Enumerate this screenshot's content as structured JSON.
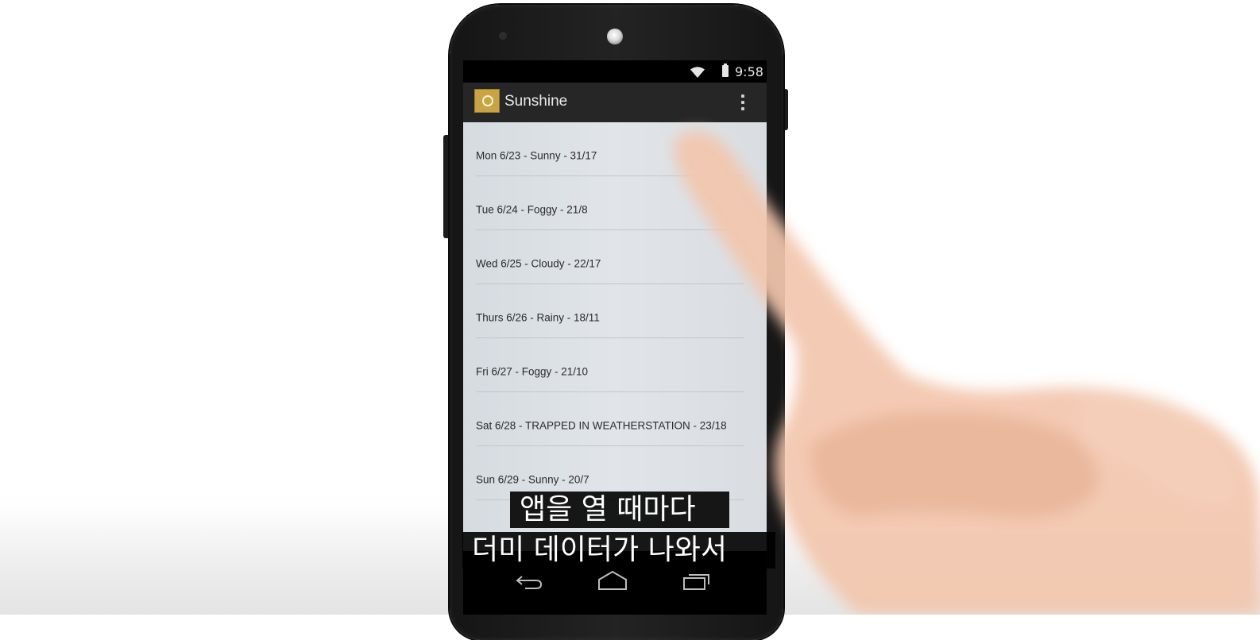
{
  "status_bar": {
    "time": "9:58",
    "wifi_icon": "wifi-icon",
    "battery_icon": "battery-icon"
  },
  "action_bar": {
    "app_icon": "sunshine-app-icon",
    "title": "Sunshine",
    "overflow_icon": "overflow-menu-icon"
  },
  "forecast_list": {
    "items": [
      {
        "label": "Mon 6/23  - Sunny - 31/17"
      },
      {
        "label": "Tue 6/24 - Foggy - 21/8"
      },
      {
        "label": "Wed 6/25 - Cloudy - 22/17"
      },
      {
        "label": "Thurs 6/26 - Rainy - 18/11"
      },
      {
        "label": "Fri 6/27 - Foggy - 21/10"
      },
      {
        "label": "Sat 6/28 - TRAPPED IN WEATHERSTATION - 23/18"
      },
      {
        "label": "Sun 6/29 - Sunny - 20/7"
      }
    ]
  },
  "nav_bar": {
    "back_icon": "back-icon",
    "home_icon": "home-icon",
    "recents_icon": "recents-icon"
  },
  "subtitles": {
    "line1": "앱을 열 때마다",
    "line2": "더미 데이터가 나와서"
  }
}
